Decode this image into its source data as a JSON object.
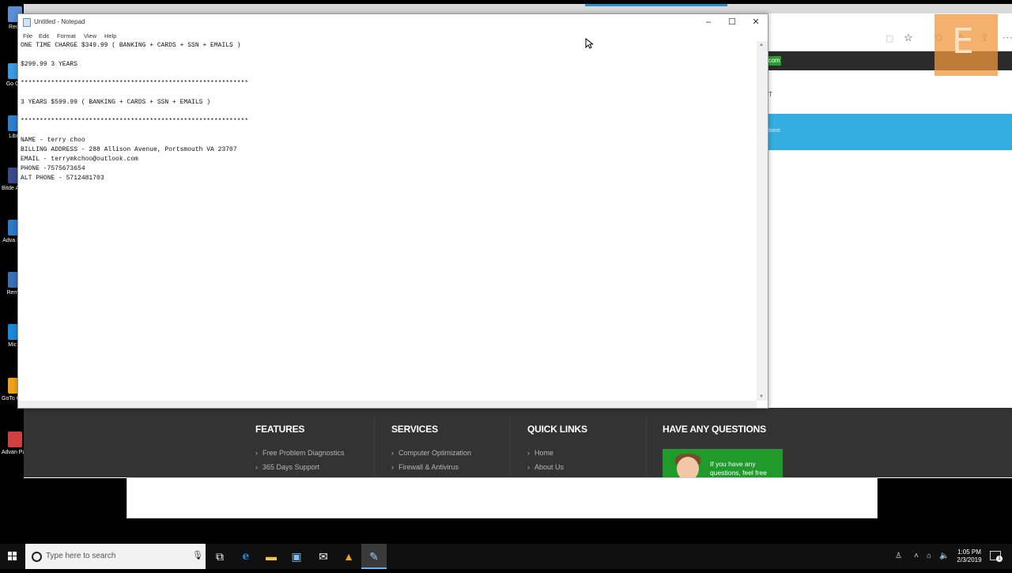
{
  "desktop": {
    "icons": [
      {
        "label": "Recy",
        "color": "#5b8fd6"
      },
      {
        "label": "Go Chr",
        "color": "#3c9be0"
      },
      {
        "label": "Libre",
        "color": "#2f7fd0"
      },
      {
        "label": "Bitde Antivi",
        "color": "#3a4a8a"
      },
      {
        "label": "Adva Iden",
        "color": "#2c7ac9"
      },
      {
        "label": "Rem A",
        "color": "#3b6fb8"
      },
      {
        "label": "Mic E",
        "color": "#1e88d8"
      },
      {
        "label": "GoTo Custo",
        "color": "#f0a21c"
      },
      {
        "label": "Advan Passw",
        "color": "#d04040"
      }
    ]
  },
  "browser": {
    "green_tag": "com",
    "nav_fragment": "T",
    "blue_band_text": "tions",
    "overlay_letter": "E"
  },
  "footer": {
    "columns": [
      {
        "title": "FEATURES",
        "items": [
          "Free Problem Diagnostics",
          "365 Days Support"
        ]
      },
      {
        "title": "SERVICES",
        "items": [
          "Computer Optimization",
          "Firewall & Antivirus"
        ]
      },
      {
        "title": "QUICK LINKS",
        "items": [
          "Home",
          "About Us"
        ]
      },
      {
        "title": "HAVE ANY QUESTIONS",
        "items": []
      }
    ],
    "promo_text_1": "If you have any",
    "promo_text_2": "questions, feel free"
  },
  "notepad": {
    "title": "Untitled - Notepad",
    "menu": [
      "File",
      "Edit",
      "Format",
      "View",
      "Help"
    ],
    "lines": [
      "ONE TIME CHARGE $349.99 ( BANKING + CARDS + SSN + EMAILS )",
      "",
      "$299.99 3 YEARS",
      "",
      "************************************************************",
      "",
      "3 YEARS $599.99 ( BANKING + CARDS + SSN + EMAILS )",
      "",
      "************************************************************",
      "",
      "NAME - terry choo",
      "BILLING ADDRESS - 288 Allison Avenue, Portsmouth VA 23707",
      "EMAIL - terrymkchoo@outlook.com",
      "PHONE -7575673654",
      "ALT PHONE - 5712481703"
    ]
  },
  "taskbar": {
    "search_placeholder": "Type here to search",
    "time": "1:05 PM",
    "date": "2/3/2019",
    "notification_count": "1",
    "accent": "#6fb1e8"
  }
}
